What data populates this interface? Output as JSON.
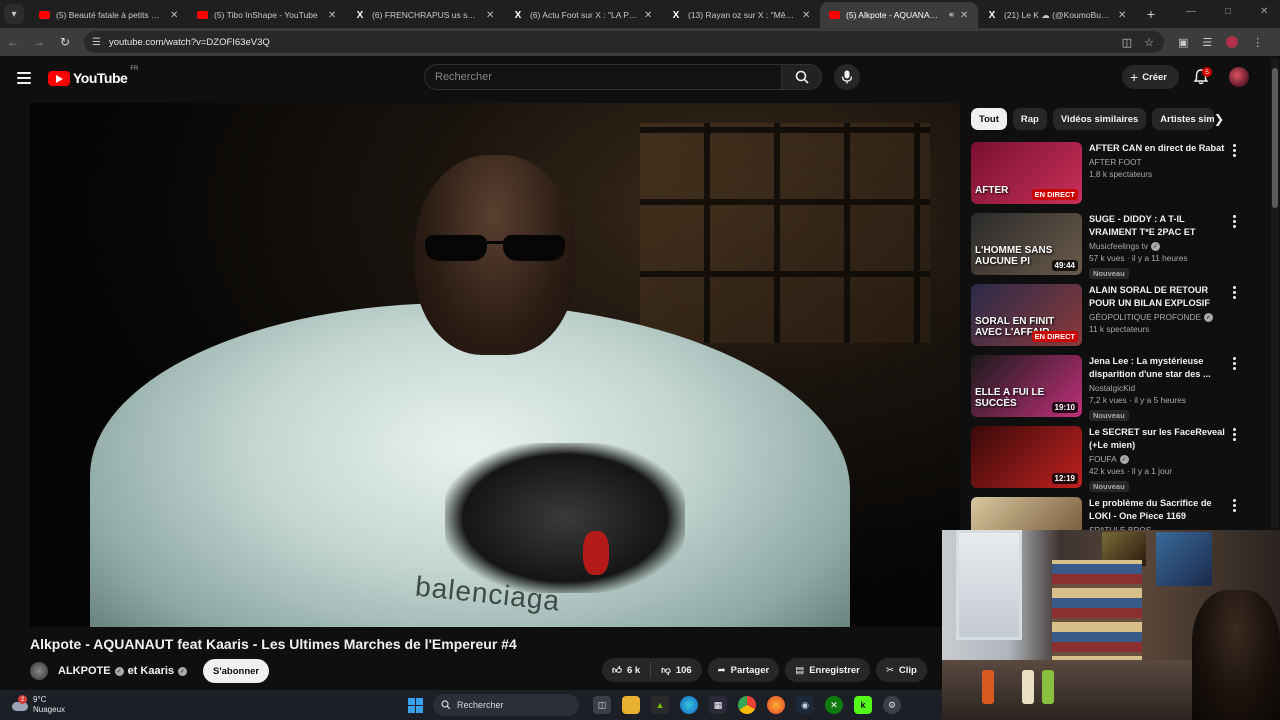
{
  "browser": {
    "tabs": [
      {
        "title": "(5) Beauté fatale à petits prix | ...",
        "favicon": "youtube-icon",
        "active": false
      },
      {
        "title": "(5) Tibo InShape - YouTube",
        "favicon": "youtube-icon",
        "active": false
      },
      {
        "title": "(6) FRENCHRAPUS us sur X : \"…",
        "favicon": "x-icon",
        "active": false
      },
      {
        "title": "(6) Actu Foot sur X : \"LA PL…",
        "favicon": "x-icon",
        "active": false
      },
      {
        "title": "(13) Rayan oz sur X : \"Même à…",
        "favicon": "x-icon",
        "active": false
      },
      {
        "title": "(5) Alkpote - AQUANAUT fe…",
        "favicon": "youtube-icon",
        "active": true
      },
      {
        "title": "(21) Le K ☁ (@KoumoBur) / X",
        "favicon": "x-icon",
        "active": false
      }
    ],
    "url": "youtube.com/watch?v=DZOFI63eV3Q"
  },
  "youtube": {
    "logo_text": "YouTube",
    "logo_country": "FR",
    "search_placeholder": "Rechercher",
    "create_label": "Créer",
    "notifications_count": "5"
  },
  "video": {
    "title": "Alkpote - AQUANAUT feat Kaaris - Les Ultimes Marches de l'Empereur #4",
    "channel": "ALKPOTE",
    "channel_joiner": "et Kaaris",
    "subscribe_label": "S'abonner",
    "likes": "6 k",
    "dislikes": "106",
    "share_label": "Partager",
    "save_label": "Enregistrer",
    "clip_label": "Clip",
    "hoodie_print": "balenciaga"
  },
  "chips": [
    "Tout",
    "Rap",
    "Vidéos similaires",
    "Artistes simi"
  ],
  "recommendations": [
    {
      "title": "AFTER CAN en direct de Rabat",
      "channel": "AFTER FOOT",
      "verified": false,
      "stats": "1,8 k spectateurs",
      "badge_text": "EN DIRECT",
      "badge_type": "live",
      "new": false,
      "thumb_colors": [
        "#7a1030",
        "#c8305a"
      ],
      "caption": "AFTER"
    },
    {
      "title": "SUGE - DIDDY : A T-IL VRAIMENT T*E 2PAC ET BIGGI...",
      "channel": "Musicfeelings tv",
      "verified": true,
      "stats": "57 k vues · il y a 11 heures",
      "badge_text": "49:44",
      "badge_type": "duration",
      "new": true,
      "new_label": "Nouveau",
      "thumb_colors": [
        "#2a2a2a",
        "#6a5a4a"
      ],
      "caption": "L'HOMME SANS AUCUNE PI"
    },
    {
      "title": "ALAIN SORAL DE RETOUR POUR UN BILAN EXPLOSIF DE...",
      "channel": "GÉOPOLITIQUE PROFONDE",
      "verified": true,
      "stats": "11 k spectateurs",
      "badge_text": "EN DIRECT",
      "badge_type": "live",
      "new": false,
      "thumb_colors": [
        "#2a2a4a",
        "#8a3a3a"
      ],
      "caption": "SORAL EN FINIT AVEC L'AFFAIR"
    },
    {
      "title": "Jena Lee : La mystérieuse disparition d'une star des ...",
      "channel": "NostalgicKid",
      "verified": false,
      "stats": "7,2 k vues · il y a 5 heures",
      "badge_text": "19:10",
      "badge_type": "duration",
      "new": true,
      "new_label": "Nouveau",
      "thumb_colors": [
        "#1a1a1a",
        "#c0307a"
      ],
      "caption": "ELLE A FUI LE SUCCÈS"
    },
    {
      "title": "Le SECRET sur les FaceReveal (+Le mien)",
      "channel": "FOUFA",
      "verified": true,
      "stats": "42 k vues · il y a 1 jour",
      "badge_text": "12:19",
      "badge_type": "duration",
      "new": true,
      "new_label": "Nouveau",
      "thumb_colors": [
        "#3a0a0a",
        "#c02020"
      ],
      "caption": ""
    },
    {
      "title": "Le problème du Sacrifice de LOKI - One Piece 1169",
      "channel": "SPATULE BROS",
      "verified": false,
      "stats": "",
      "badge_text": "",
      "badge_type": "none",
      "new": false,
      "thumb_colors": [
        "#d8c8a0",
        "#6a4a2a"
      ],
      "caption": ""
    }
  ],
  "taskbar": {
    "temperature": "9°C",
    "condition": "Nuageux",
    "weather_badge": "2",
    "search_label": "Rechercher"
  },
  "colors": {
    "background": "#0f0f0f",
    "youtube_red": "#ff0000",
    "chip_active": "#f1f1f1",
    "live_red": "#cc0000"
  }
}
